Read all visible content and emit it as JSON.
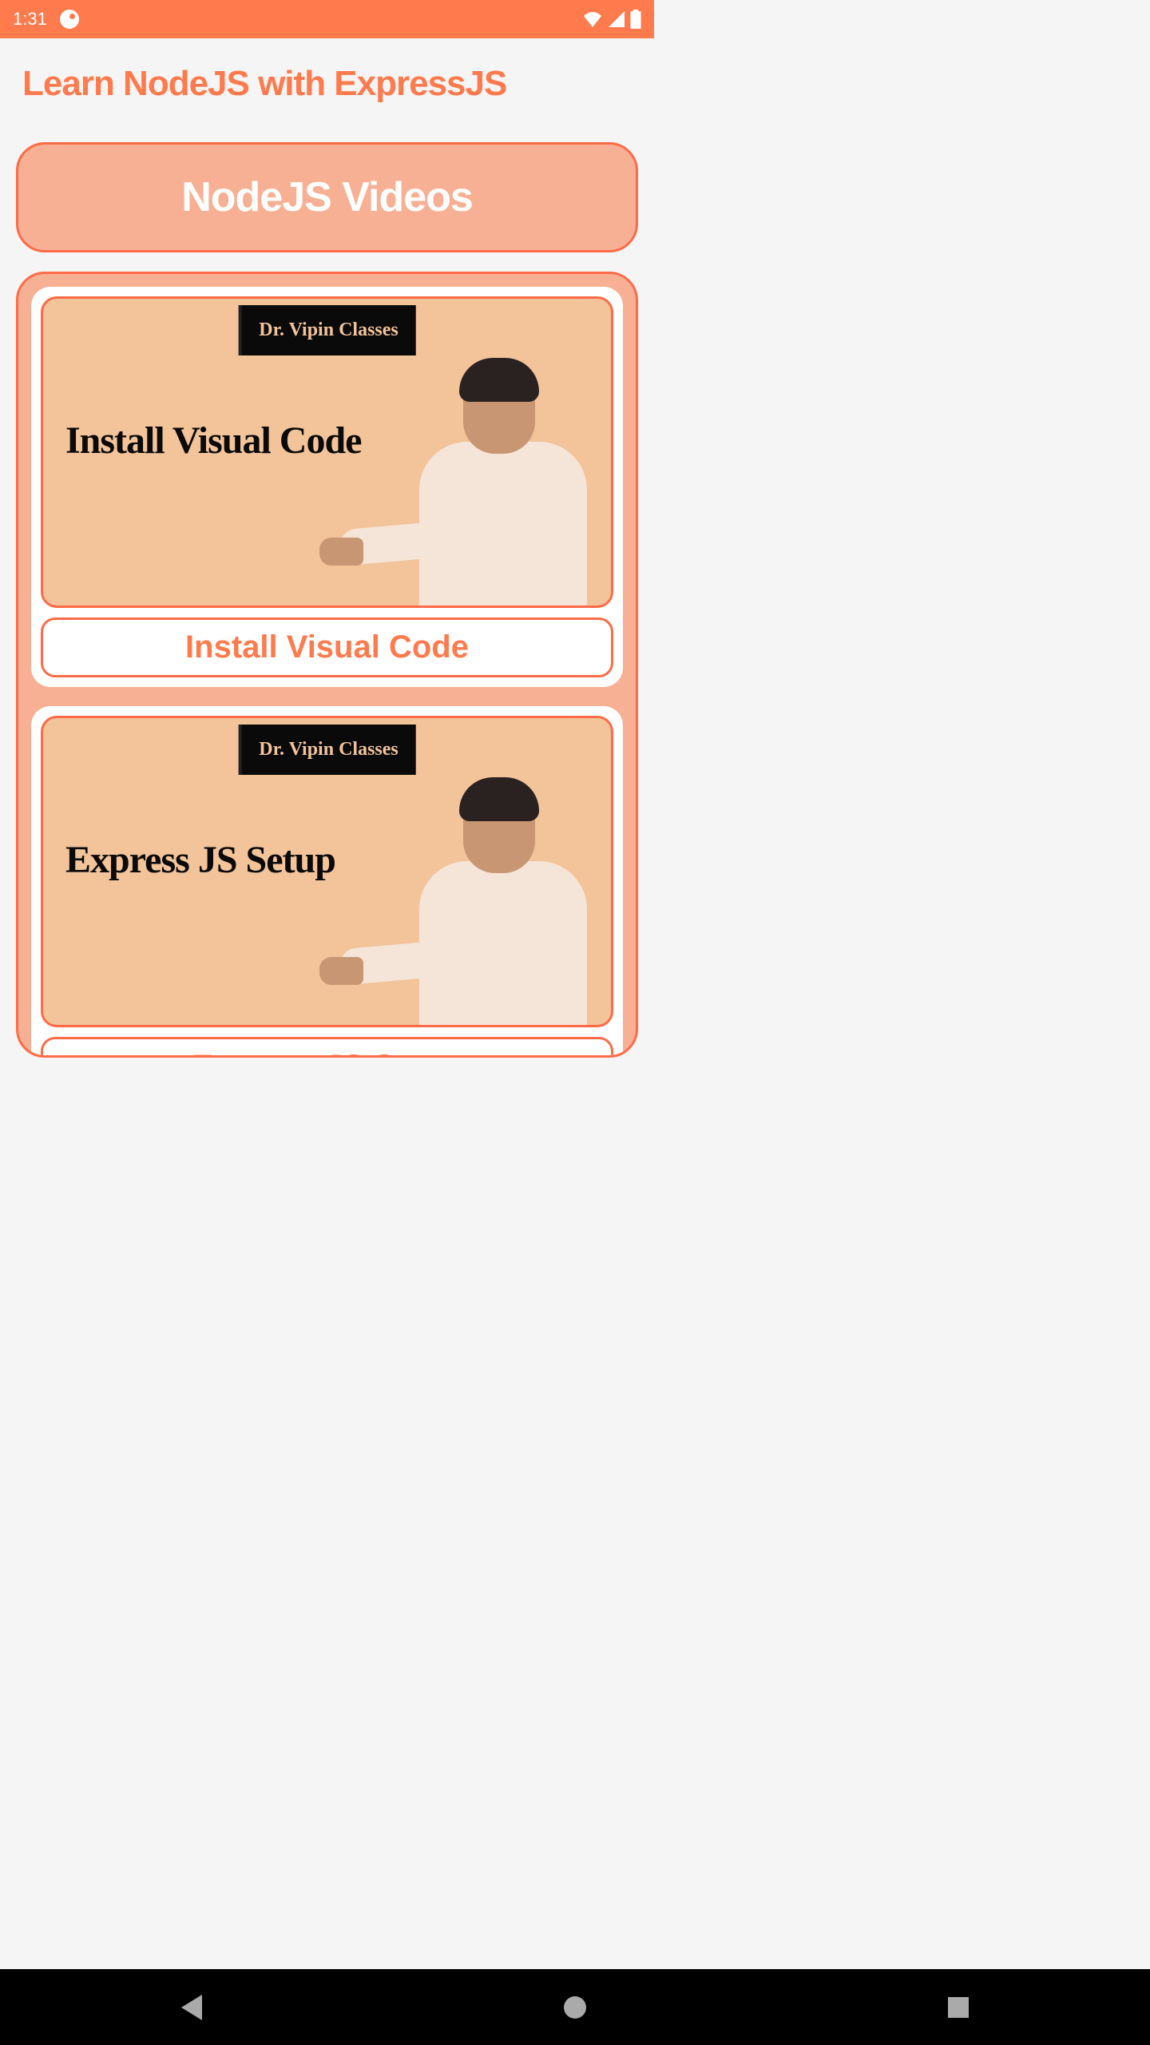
{
  "statusBar": {
    "time": "1:31"
  },
  "header": {
    "title": "Learn NodeJS with ExpressJS"
  },
  "section": {
    "label": "NodeJS Videos"
  },
  "videos": [
    {
      "badge": "Dr. Vipin Classes",
      "thumbTitle": "Install Visual Code",
      "label": "Install Visual Code"
    },
    {
      "badge": "Dr. Vipin Classes",
      "thumbTitle": "Express JS Setup",
      "label": "Express JS Setup"
    }
  ]
}
